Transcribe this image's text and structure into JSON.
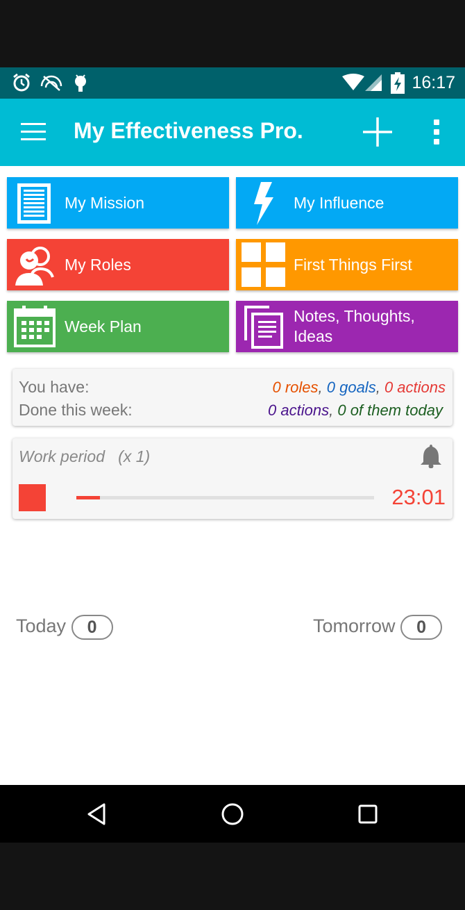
{
  "status_bar": {
    "time": "16:17",
    "left_icons": [
      "alarm-icon",
      "cast-off-icon",
      "android-icon"
    ],
    "right_icons": [
      "wifi-icon",
      "signal-icon",
      "battery-charging-icon"
    ]
  },
  "app_bar": {
    "title": "My Effectiveness Pro.",
    "color": "#00bcd4"
  },
  "tiles": [
    {
      "label": "My Mission",
      "color": "#03a9f4",
      "icon": "document-lines-icon"
    },
    {
      "label": "My Influence",
      "color": "#03a9f4",
      "icon": "lightning-icon"
    },
    {
      "label": "My Roles",
      "color": "#f44336",
      "icon": "people-icon"
    },
    {
      "label": "First Things First",
      "color": "#ff9800",
      "icon": "grid-quadrants-icon"
    },
    {
      "label": "Week Plan",
      "color": "#4caf50",
      "icon": "calendar-icon"
    },
    {
      "label_line1": "Notes, Thoughts,",
      "label_line2": "Ideas",
      "color": "#9c27b0",
      "icon": "notes-copy-icon"
    }
  ],
  "stats": {
    "you_have_label": "You have:",
    "done_label": "Done this week:",
    "roles": "0 roles",
    "goals": "0 goals",
    "actions": "0 actions",
    "done_actions": "0 actions",
    "done_today": "0 of them today",
    "sep": ", "
  },
  "timer": {
    "label": "Work period",
    "multiplier": "(x 1)",
    "time": "23:01",
    "progress": 0.08,
    "accent": "#f44336"
  },
  "counters": {
    "today_label": "Today",
    "today_count": "0",
    "tomorrow_label": "Tomorrow",
    "tomorrow_count": "0"
  }
}
